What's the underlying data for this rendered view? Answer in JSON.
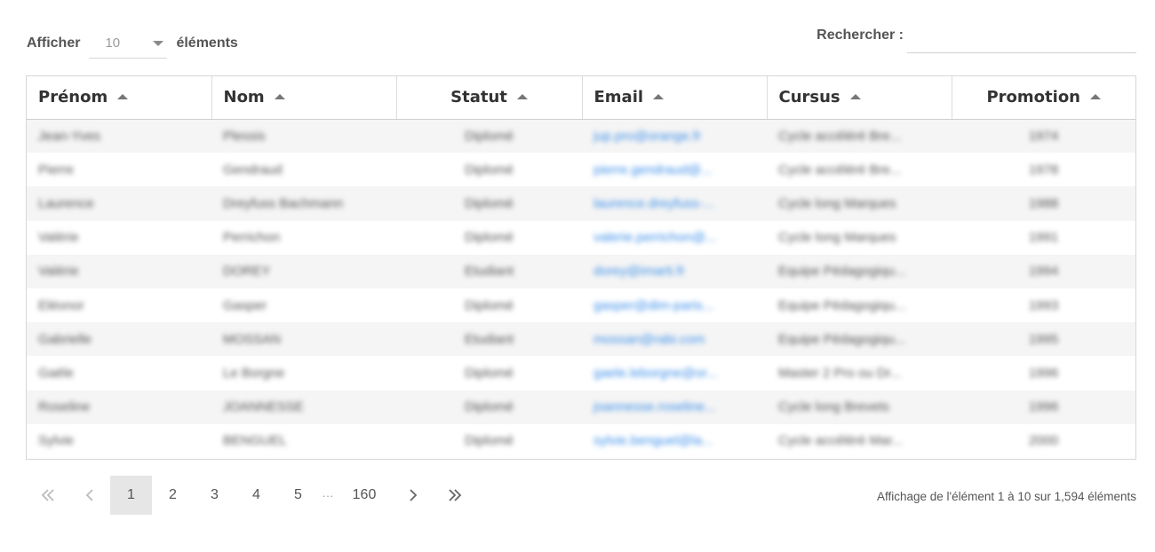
{
  "controls": {
    "length_label_before": "Afficher",
    "length_value": "10",
    "length_label_after": "éléments",
    "search_label": "Rechercher :",
    "search_value": ""
  },
  "table": {
    "columns": [
      {
        "label": "Prénom",
        "align": "left"
      },
      {
        "label": "Nom",
        "align": "left"
      },
      {
        "label": "Statut",
        "align": "center"
      },
      {
        "label": "Email",
        "align": "left"
      },
      {
        "label": "Cursus",
        "align": "left"
      },
      {
        "label": "Promotion",
        "align": "center"
      }
    ],
    "rows": [
      [
        "Jean-Yves",
        "Plessis",
        "Diplomé",
        "jup.pro@orange.fr",
        "Cycle accéléré Bre...",
        "1974"
      ],
      [
        "Pierre",
        "Gendraud",
        "Diplomé",
        "pierre.gendraud@...",
        "Cycle accéléré Bre...",
        "1978"
      ],
      [
        "Laurence",
        "Dreyfuss Bachmann",
        "Diplomé",
        "laurence.dreyfuss-...",
        "Cycle long Marques",
        "1988"
      ],
      [
        "Valérie",
        "Perrichon",
        "Diplomé",
        "valerie.perrichon@...",
        "Cycle long Marques",
        "1991"
      ],
      [
        "Valérie",
        "DOREY",
        "Etudiant",
        "dorey@imarti.fr",
        "Equipe Pédagogiqu...",
        "1994"
      ],
      [
        "Eléonor",
        "Gasper",
        "Diplomé",
        "gasper@dim-paris...",
        "Equipe Pédagogiqu...",
        "1993"
      ],
      [
        "Gabrielle",
        "MOSSAN",
        "Etudiant",
        "mossan@rabi.com",
        "Equipe Pédagogiqu...",
        "1995"
      ],
      [
        "Gaële",
        "Le Borgne",
        "Diplomé",
        "gaele.leborgne@or...",
        "Master 2 Pro ou Dr...",
        "1996"
      ],
      [
        "Roseline",
        "JOANNESSE",
        "Diplomé",
        "joannesse.roseline...",
        "Cycle long Brevets",
        "1996"
      ],
      [
        "Sylvie",
        "BENGUEL",
        "Diplomé",
        "sylvie.benguel@la...",
        "Cycle accéléré Mar...",
        "2000"
      ]
    ]
  },
  "pagination": {
    "first_icon": "double-chevron-left-icon",
    "prev_icon": "chevron-left-icon",
    "next_icon": "chevron-right-icon",
    "last_icon": "double-chevron-right-icon",
    "pages": [
      "1",
      "2",
      "3",
      "4",
      "5"
    ],
    "ellipsis": "···",
    "last_page": "160",
    "current": "1"
  },
  "info_text": "Affichage de l'élément 1 à 10 sur 1,594 éléments"
}
